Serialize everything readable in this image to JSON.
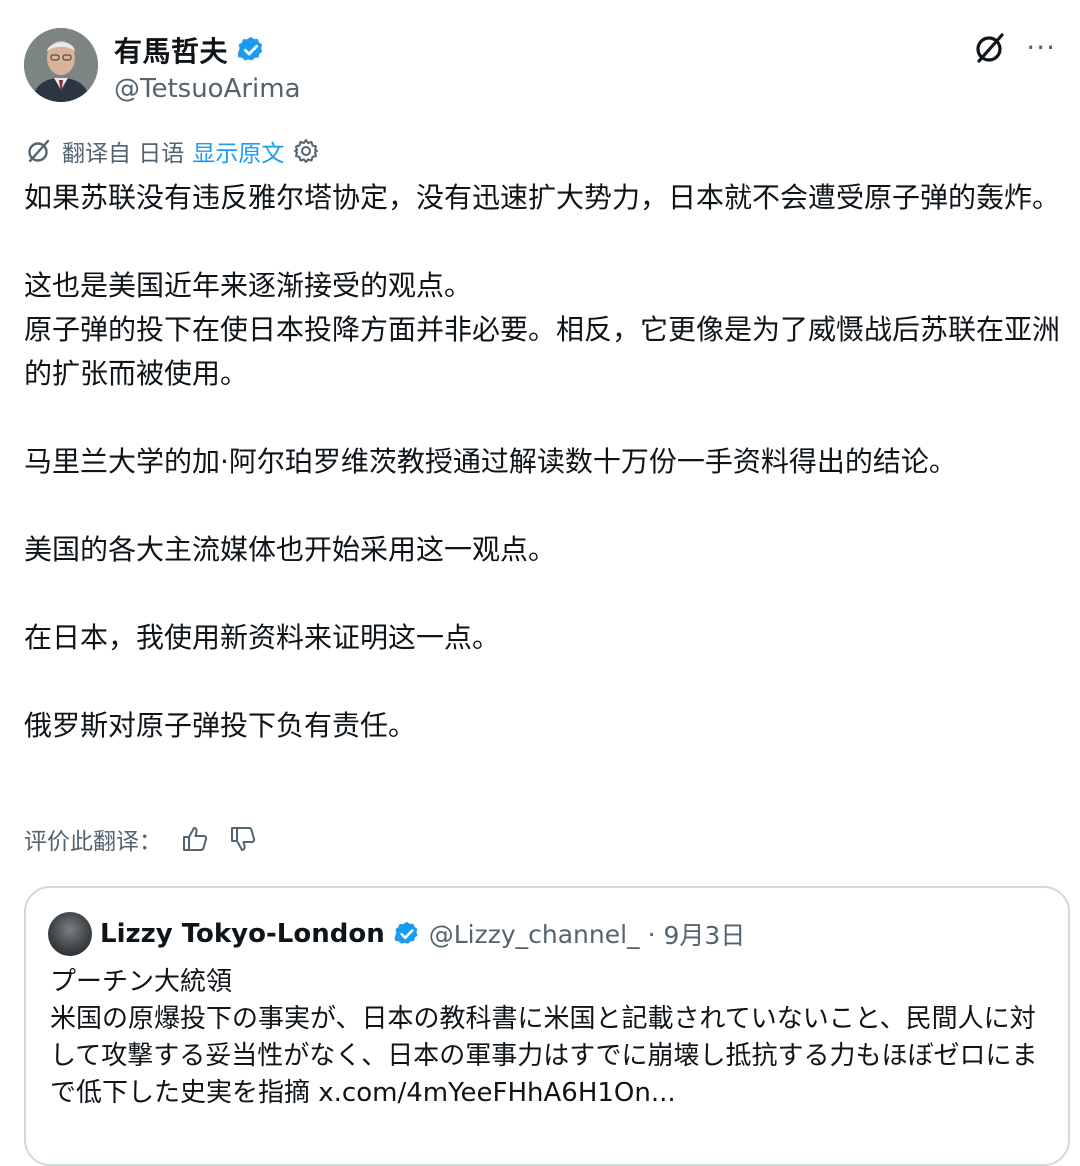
{
  "author": {
    "display_name": "有馬哲夫",
    "handle": "@TetsuoArima"
  },
  "top_actions": {
    "more_label": "···"
  },
  "translation": {
    "translated_from": "翻译自 日语",
    "show_original": "显示原文"
  },
  "post_paragraphs": [
    "如果苏联没有违反雅尔塔协定，没有迅速扩大势力，日本就不会遭受原子弹的轰炸。",
    "这也是美国近年来逐渐接受的观点。\n原子弹的投下在使日本投降方面并非必要。相反，它更像是为了威慑战后苏联在亚洲的扩张而被使用。",
    "马里兰大学的加·阿尔珀罗维茨教授通过解读数十万份一手资料得出的结论。",
    "美国的各大主流媒体也开始采用这一观点。",
    "在日本，我使用新资料来证明这一点。",
    "俄罗斯对原子弹投下负有责任。"
  ],
  "rating": {
    "label": "评价此翻译："
  },
  "quote": {
    "display_name": "Lizzy Tokyo-London",
    "handle": "@Lizzy_channel_",
    "separator": "·",
    "date": "9月3日",
    "line1": "プーチン大統領",
    "line2": "米国の原爆投下の事実が、日本の教科書に米国と記載されていないこと、民間人に対して攻撃する妥当性がなく、日本の軍事力はすでに崩壊し抵抗する力もほぼゼロにまで低下した史実を指摘",
    "link": "x.com/4mYeeFHhA6H1On..."
  },
  "colors": {
    "accent": "#1d9bf0",
    "muted": "#536471",
    "text": "#0f1419",
    "border": "#cfd9de"
  }
}
